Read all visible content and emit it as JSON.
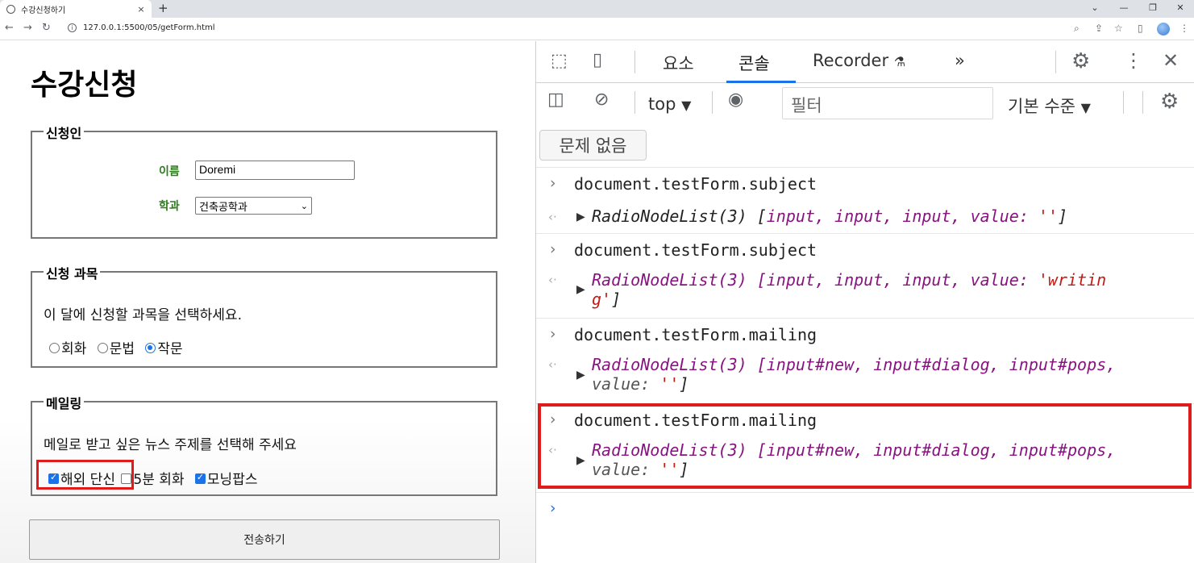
{
  "browser": {
    "tab_title": "수강신청하기",
    "tab_close": "×",
    "new_tab": "+",
    "url": "127.0.0.1:5500/05/getForm.html",
    "window_controls": [
      "⌄",
      "—",
      "❐",
      "✕"
    ]
  },
  "form": {
    "heading": "수강신청",
    "applicant": {
      "legend": "신청인",
      "name_label": "이름",
      "name_value": "Doremi",
      "dept_label": "학과",
      "dept_value": "건축공학과"
    },
    "subject": {
      "legend": "신청 과목",
      "instruction": "이 달에 신청할 과목을 선택하세요.",
      "options": [
        {
          "label": "회화",
          "checked": false
        },
        {
          "label": "문법",
          "checked": false
        },
        {
          "label": "작문",
          "checked": true
        }
      ]
    },
    "mailing": {
      "legend": "메일링",
      "instruction": "메일로 받고 싶은 뉴스 주제를 선택해 주세요",
      "options": [
        {
          "label": "해외 단신",
          "checked": true
        },
        {
          "label": "5분 회화",
          "checked": false
        },
        {
          "label": "모닝팝스",
          "checked": true
        }
      ]
    },
    "submit_label": "전송하기"
  },
  "devtools": {
    "tabs": [
      "요소",
      "콘솔",
      "Recorder"
    ],
    "active_tab": "콘솔",
    "more_tabs": "»",
    "context": "top",
    "filter_placeholder": "필터",
    "level": "기본 수준",
    "issues_button": "문제 없음",
    "console": [
      {
        "command": "document.testForm.subject",
        "result_head": "RadioNodeList(3) [",
        "items": "input, input, input",
        "value_key": "value: ",
        "value": "''",
        "tail": "]"
      },
      {
        "command": "document.testForm.subject",
        "result_line1": "RadioNodeList(3) [input, input, input, value: ",
        "value_part1": "'writin",
        "value_part2": "g'",
        "tail": "]"
      },
      {
        "command": "document.testForm.mailing",
        "result_line1": "RadioNodeList(3) [input#new, input#dialog, input#pops,",
        "value_key": "value: ",
        "value": "''",
        "tail": "]"
      },
      {
        "command": "document.testForm.mailing",
        "result_line1": "RadioNodeList(3) [input#new, input#dialog, input#pops,",
        "value_key": "value: ",
        "value": "''",
        "tail": "]"
      }
    ]
  },
  "colors": {
    "label_green": "#2e7d1d",
    "accent_blue": "#1a73e8",
    "highlight_red": "#e01b1b"
  }
}
